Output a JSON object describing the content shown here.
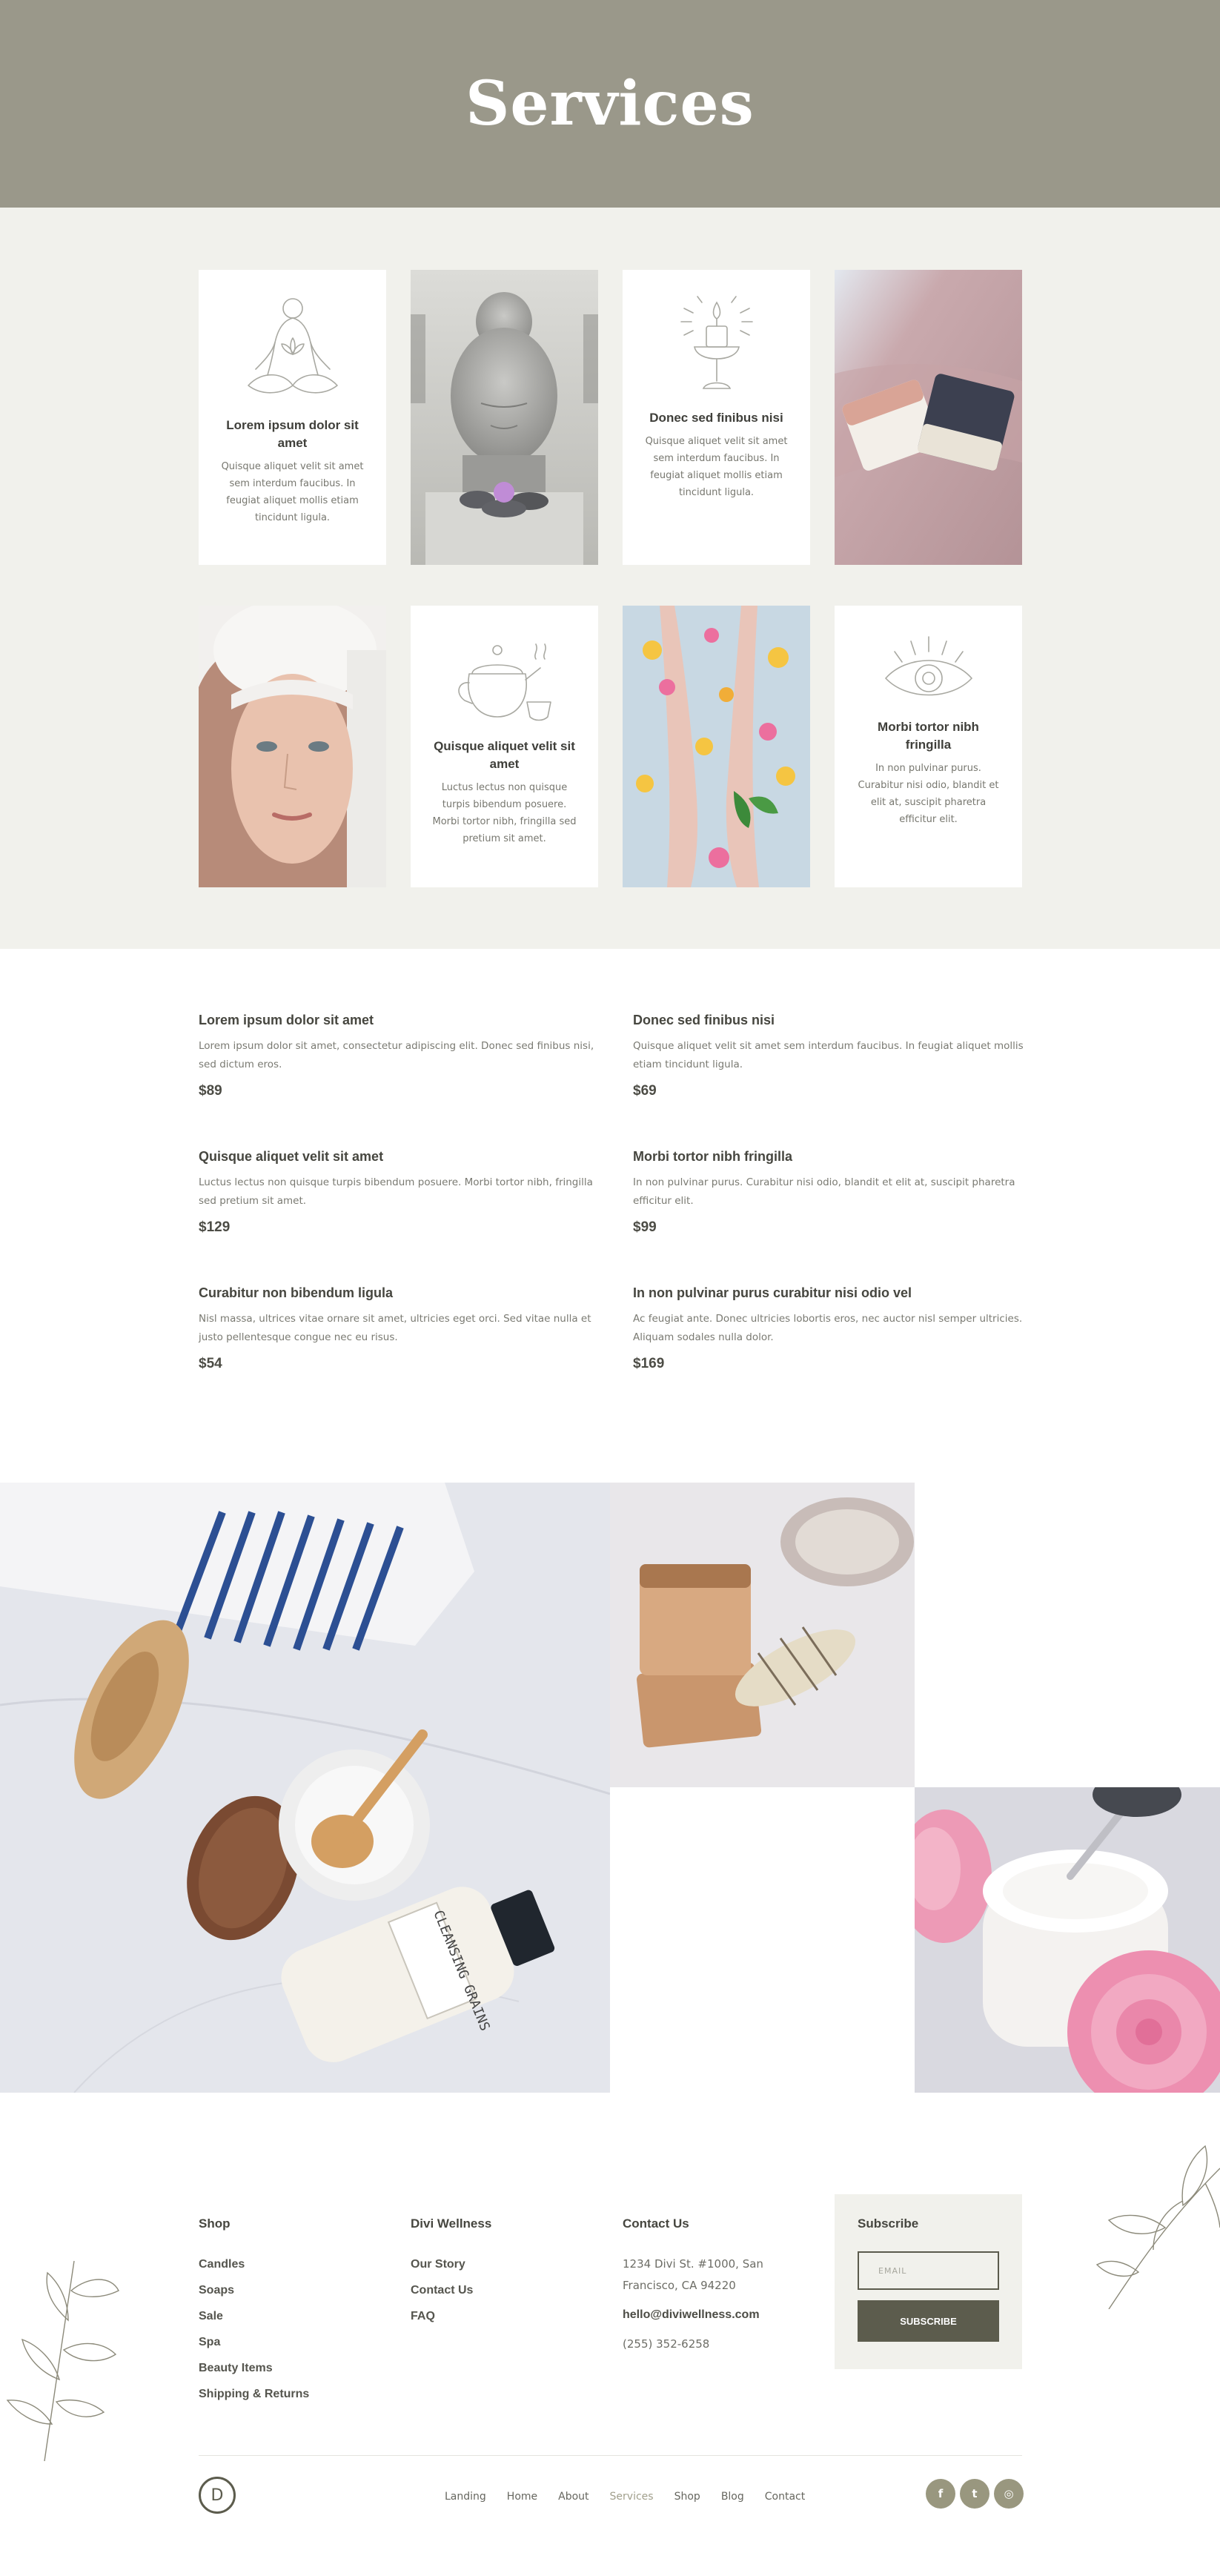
{
  "hero": {
    "title": "Services"
  },
  "services": [
    {
      "title": "Lorem ipsum dolor sit amet",
      "text": "Quisque aliquet velit sit amet sem interdum faucibus. In feugiat aliquet mollis etiam tincidunt ligula.",
      "icon": "meditation-icon"
    },
    {
      "title": "Donec sed finibus nisi",
      "text": "Quisque aliquet velit sit amet sem interdum faucibus. In feugiat aliquet mollis etiam tincidunt ligula.",
      "icon": "candle-icon"
    },
    {
      "title": "Quisque aliquet velit sit amet",
      "text": "Luctus lectus non quisque turpis bibendum posuere. Morbi tortor nibh, fringilla sed pretium sit amet.",
      "icon": "teapot-icon"
    },
    {
      "title": "Morbi tortor nibh fringilla",
      "text": "In non pulvinar purus. Curabitur nisi odio, blandit et elit at, suscipit pharetra efficitur elit.",
      "icon": "eye-icon"
    }
  ],
  "prices": [
    {
      "title": "Lorem ipsum dolor sit amet",
      "desc": "Lorem ipsum dolor sit amet, consectetur adipiscing elit. Donec sed finibus nisi, sed dictum eros.",
      "price": "$89"
    },
    {
      "title": "Donec sed finibus nisi",
      "desc": "Quisque aliquet velit sit amet sem interdum faucibus. In feugiat aliquet mollis etiam tincidunt ligula.",
      "price": "$69"
    },
    {
      "title": "Quisque aliquet velit sit amet",
      "desc": "Luctus lectus non quisque turpis bibendum posuere. Morbi tortor nibh, fringilla sed pretium sit amet.",
      "price": "$129"
    },
    {
      "title": "Morbi tortor nibh fringilla",
      "desc": "In non pulvinar purus. Curabitur nisi odio, blandit et elit at, suscipit pharetra efficitur elit.",
      "price": "$99"
    },
    {
      "title": "Curabitur non bibendum ligula",
      "desc": "Nisl massa, ultrices vitae ornare sit amet, ultricies eget orci. Sed vitae nulla et justo pellentesque congue nec eu risus.",
      "price": "$54"
    },
    {
      "title": "In non pulvinar purus curabitur nisi odio vel",
      "desc": "Ac feugiat ante. Donec ultricies lobortis eros, nec auctor nisl semper ultricies. Aliquam sodales nulla dolor.",
      "price": "$169"
    }
  ],
  "gallery": {
    "bottle_label": "CLEANSING GRAINS"
  },
  "footer": {
    "shop": {
      "heading": "Shop",
      "links": [
        "Candles",
        "Soaps",
        "Sale",
        "Spa",
        "Beauty Items",
        "Shipping & Returns"
      ]
    },
    "brand": {
      "heading": "Divi Wellness",
      "links": [
        "Our Story",
        "Contact Us",
        "FAQ"
      ]
    },
    "contact": {
      "heading": "Contact Us",
      "address_line1": "1234 Divi St. #1000, San",
      "address_line2": "Francisco, CA 94220",
      "email": "hello@diviwellness.com",
      "phone": "(255) 352-6258"
    },
    "subscribe": {
      "heading": "Subscribe",
      "placeholder": "EMAIL",
      "button": "SUBSCRIBE"
    },
    "nav": [
      "Landing",
      "Home",
      "About",
      "Services",
      "Shop",
      "Blog",
      "Contact"
    ],
    "nav_active": "Services",
    "social": [
      {
        "icon": "facebook-icon",
        "glyph": "f"
      },
      {
        "icon": "twitter-icon",
        "glyph": "t"
      },
      {
        "icon": "instagram-icon",
        "glyph": "◎"
      }
    ],
    "logo_letter": "D"
  },
  "colors": {
    "hero": "#9a988a",
    "section_bg": "#f1f1ec",
    "accent": "#5c5c4d",
    "social": "#99977f",
    "active_nav": "#a19f8c"
  }
}
